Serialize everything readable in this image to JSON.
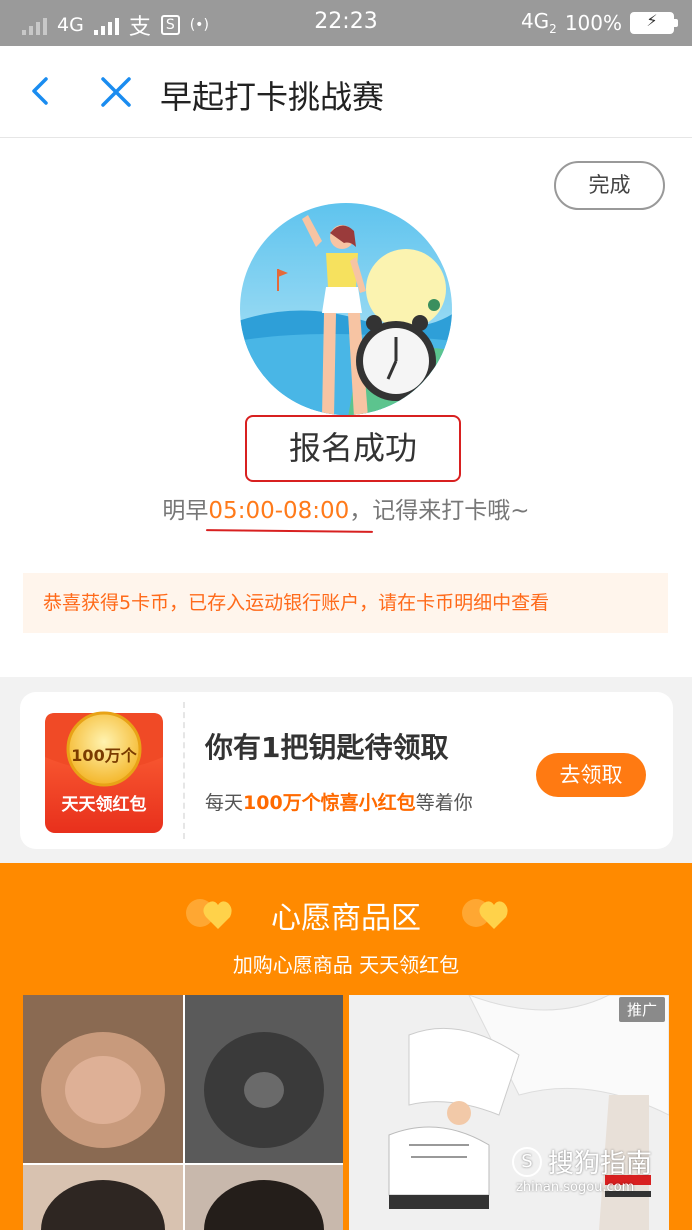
{
  "status_bar": {
    "network_1": "4G",
    "alipay_glyph": "支",
    "sim_glyph": "S",
    "hotspot_glyph": "(•)",
    "time": "22:23",
    "network_2": "4G",
    "network_2_sub": "2",
    "battery": "100%",
    "battery_glyph": "⚡"
  },
  "header": {
    "title": "早起打卡挑战赛",
    "back_icon": "chevron-left-icon",
    "close_icon": "close-icon"
  },
  "signup": {
    "done_label": "完成",
    "success_label": "报名成功",
    "time_prefix": "明早",
    "time_range": "05:00-08:00",
    "time_suffix": "，记得来打卡哦~",
    "notice": "恭喜获得5卡币，已存入运动银行账户，请在卡币明细中查看"
  },
  "red_packet": {
    "coin_text": "100万个",
    "packet_label": "天天领红包",
    "title": "你有1把钥匙待领取",
    "sub_prefix": "每天",
    "sub_highlight": "100万个惊喜小红包",
    "sub_suffix": "等着你",
    "claim_label": "去领取"
  },
  "wish": {
    "title": "心愿商品区",
    "subtitle": "加购心愿商品 天天领红包",
    "ad_badge": "推广"
  },
  "watermark": {
    "logo": "S",
    "brand": "搜狗指南",
    "url": "zhinan.sogou.com"
  },
  "colors": {
    "accent_blue": "#1a8cf0",
    "orange": "#ff8a00",
    "highlight_orange": "#ff7a1a",
    "annotation_red": "#d82020"
  }
}
